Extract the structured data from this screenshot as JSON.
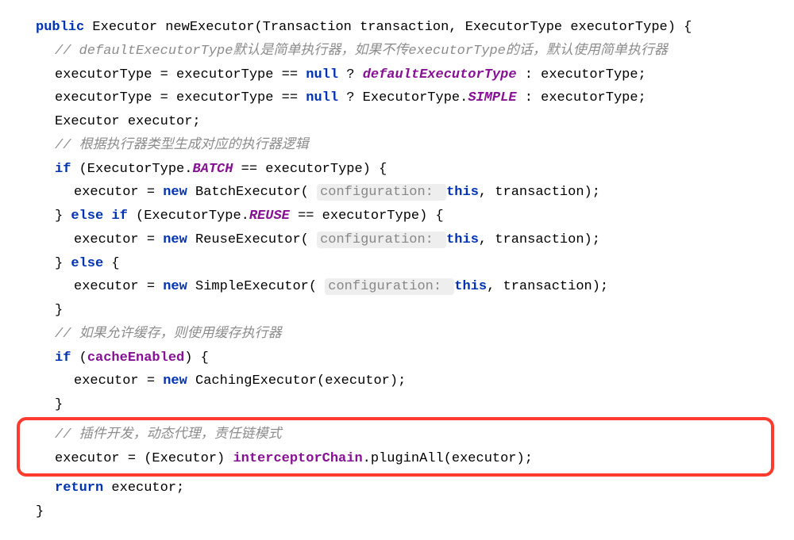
{
  "code": {
    "l1a": "public",
    "l1b": " Executor newExecutor(Transaction transaction, ExecutorType executorType) {",
    "l2": "// defaultExecutorType默认是简单执行器，如果不传executorType的话，默认使用简单执行器",
    "l3a": "executorType = executorType == ",
    "l3b": "null",
    "l3c": " ? ",
    "l3d": "defaultExecutorType",
    "l3e": " : executorType;",
    "l4a": "executorType = executorType == ",
    "l4b": "null",
    "l4c": " ? ExecutorType.",
    "l4d": "SIMPLE",
    "l4e": " : executorType;",
    "l5": "Executor executor;",
    "l6": "// 根据执行器类型生成对应的执行器逻辑",
    "l7a": "if",
    "l7b": " (ExecutorType.",
    "l7c": "BATCH",
    "l7d": " == executorType) {",
    "hint": "configuration: ",
    "l8a": "executor = ",
    "l8b": "new",
    "l8c": " BatchExecutor( ",
    "l8d": "this",
    "l8e": ", transaction);",
    "l9a": "} ",
    "l9b": "else if",
    "l9c": " (ExecutorType.",
    "l9d": "REUSE",
    "l9e": " == executorType) {",
    "l10c": " ReuseExecutor( ",
    "l11b": "else",
    "l11c": " {",
    "l12c": " SimpleExecutor( ",
    "l13": "}",
    "l14": "// 如果允许缓存，则使用缓存执行器",
    "l15a": "if",
    "l15b": " (",
    "l15c": "cacheEnabled",
    "l15d": ") {",
    "l16c": " CachingExecutor(executor);",
    "l18": "// 插件开发，动态代理，责任链模式",
    "l19a": "executor = (Executor) ",
    "l19b": "interceptorChain",
    "l19c": ".pluginAll(executor);",
    "l20a": "return",
    "l20b": " executor;",
    "l21": "}"
  }
}
